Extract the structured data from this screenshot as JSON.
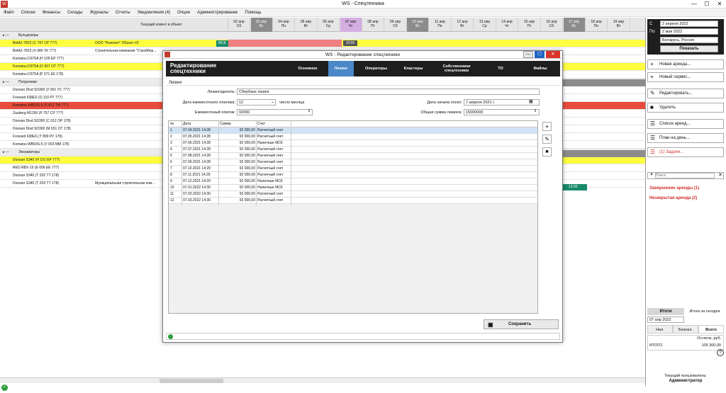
{
  "app": {
    "title": "WS - Спецтехника"
  },
  "menu": [
    "Файл",
    "Списки",
    "Финансы",
    "Склады",
    "Журналы",
    "Отчеты",
    "Уведомления (4)",
    "Опции",
    "Администрирование",
    "Помощь"
  ],
  "grid": {
    "col_client": "Текущий клиент и объект",
    "days": [
      {
        "d": "02 апр",
        "w": "Сб"
      },
      {
        "d": "03 апр",
        "w": "Вс"
      },
      {
        "d": "04 апр",
        "w": "Пн"
      },
      {
        "d": "05 апр",
        "w": "Вт"
      },
      {
        "d": "06 апр",
        "w": "Ср"
      },
      {
        "d": "07 апр",
        "w": "Чт"
      },
      {
        "d": "08 апр",
        "w": "Пт"
      },
      {
        "d": "09 апр",
        "w": "Сб"
      },
      {
        "d": "10 апр",
        "w": "Вс"
      },
      {
        "d": "11 апр",
        "w": "Пн"
      },
      {
        "d": "12 апр",
        "w": "Вт"
      },
      {
        "d": "13 апр",
        "w": "Ср"
      },
      {
        "d": "14 апр",
        "w": "Чт"
      },
      {
        "d": "15 апр",
        "w": "Пт"
      },
      {
        "d": "16 апр",
        "w": "Сб"
      },
      {
        "d": "17 апр",
        "w": "Вс"
      },
      {
        "d": "18 апр",
        "w": "Пн"
      },
      {
        "d": "19 апр",
        "w": "Вт"
      }
    ],
    "rows": [
      {
        "name": "Бульдозеры",
        "group": true
      },
      {
        "name": "BelAZ-7823 (С 797 СР 777)",
        "client": "ООО \"Резолют\"  Объект #3",
        "style": "yel",
        "msk": "МСК"
      },
      {
        "name": "BelAZ-7823 (Х 980 ТК 777)",
        "client": "Строительная компания \"Стройбер..."
      },
      {
        "name": "Komatsu D375A (Н 100 ЕР 777)",
        "client": ""
      },
      {
        "name": "Komatsu D375A (О 657 ОТ 777)",
        "client": "",
        "style": "yel"
      },
      {
        "name": "Komatsu D375A (Р 371 ЕК 178)",
        "client": ""
      },
      {
        "name": "Погрузчики",
        "group": true
      },
      {
        "name": "Doosan Disd SD300 (У 901 УС 777)",
        "client": ""
      },
      {
        "name": "Forward 638ES (О 110 РТ 777)",
        "client": ""
      },
      {
        "name": "Komatsu WB93S-5 (Х 812 ТМ 777)",
        "client": "",
        "style": "red"
      },
      {
        "name": "Zauberg M1250 (Р 757 СР 777)",
        "client": ""
      },
      {
        "name": "Doosan Disd SD300 (С 012 ОР 178)",
        "client": ""
      },
      {
        "name": "Doosan Disd SD300 (М 651 ОТ 178)",
        "client": ""
      },
      {
        "name": "Forward 638ES (Т 899 РУ 178)",
        "client": ""
      },
      {
        "name": "Komatsu WB93S-5 (У 003 ММ 178)",
        "client": ""
      },
      {
        "name": "Экскаваторы",
        "group": true
      },
      {
        "name": "Doosan S340 (Н 101 ЕР 777)",
        "client": "",
        "style": "yel"
      },
      {
        "name": "RED RBX-15 (Е 606 ЕЕ 777)",
        "client": ""
      },
      {
        "name": "Doosan S340 (Т 202 ТТ 178)",
        "client": ""
      },
      {
        "name": "Doosan S340 (Т 203 ТТ 178)",
        "client": "Муниципальная строительная ком..."
      }
    ],
    "bar_times": [
      "15:00",
      "13:00"
    ]
  },
  "right": {
    "from_label": "С",
    "from_value": "2  апреля  2022",
    "to_label": "По",
    "to_value": "2    мая    2022",
    "region": "Беларусь, Россия",
    "show": "Показать",
    "buttons": [
      "Новая аренда...",
      "Новый сервис...",
      "Редактировать...",
      "Удалить",
      "Список аренд...",
      "План на день...",
      "(1) Задачи..."
    ],
    "search_placeholder": "Поиск",
    "alerts": [
      "Завершение аренды (1)",
      "Незакрытая аренда (2)"
    ],
    "totals_label": "Итоги",
    "totals_today": "Итоги за сегодня",
    "totals_date": "07 апр  2022",
    "tabs": [
      "Нал.",
      "Безнал.",
      "Всего"
    ],
    "balance_label": "Остаток, руб.",
    "total_row": "ИТОГО",
    "total_val": "105 300,00",
    "current_user_label": "Текущий пользователь:",
    "current_user": "Администратор"
  },
  "modal": {
    "title": "WS - Редактирование спецтехники",
    "header": "Редактирование спецтехники",
    "tabs": [
      "Основное",
      "Лизинг",
      "Операторы",
      "Кластеры",
      "Собственники спецтехники",
      "ТО",
      "Файлы"
    ],
    "section": "Лизинг",
    "lessor_label": "Лизингодатель:",
    "lessor_value": "Сбербанк лизинг",
    "payday_label": "Дата ежемесячного платежа:",
    "payday_value": "12",
    "payday_suffix": "число месяца",
    "start_label": "Дата начала оплат:",
    "start_value": "7   апреля   2021 г.",
    "monthly_label": "Ежемесячный платеж:",
    "monthly_value": "92000",
    "total_label": "Общая сумма лизинга:",
    "total_value": "15000000",
    "table_headers": [
      "№",
      "Дата",
      "Сумма",
      "Счет"
    ],
    "rows": [
      [
        "1",
        "07.04.2021 14:28",
        "92 000,00",
        "Расчетный счет"
      ],
      [
        "2",
        "07.05.2021 14:28",
        "92 000,00",
        "Расчетный счет"
      ],
      [
        "3",
        "07.06.2021 14:28",
        "92 000,00",
        "Наличные МСК"
      ],
      [
        "4",
        "07.07.2021 14:28",
        "92 000,00",
        "Расчетный счет"
      ],
      [
        "5",
        "07.08.2021 14:28",
        "92 000,00",
        "Расчетный счет"
      ],
      [
        "6",
        "07.09.2021 14:28",
        "92 000,00",
        "Расчетный счет"
      ],
      [
        "7",
        "07.10.2021 14:29",
        "92 000,00",
        "Расчетный счет"
      ],
      [
        "8",
        "07.11.2021 14:29",
        "92 000,00",
        "Расчетный счет"
      ],
      [
        "9",
        "07.12.2021 14:29",
        "92 000,00",
        "Наличные МСК"
      ],
      [
        "10",
        "07.01.2022 14:30",
        "92 000,00",
        "Наличные МСК"
      ],
      [
        "11",
        "07.02.2022 14:30",
        "92 000,00",
        "Расчетный счет"
      ],
      [
        "12",
        "07.03.2022 14:30",
        "92 000,00",
        "Расчетный счет"
      ]
    ],
    "save": "Сохранить"
  }
}
